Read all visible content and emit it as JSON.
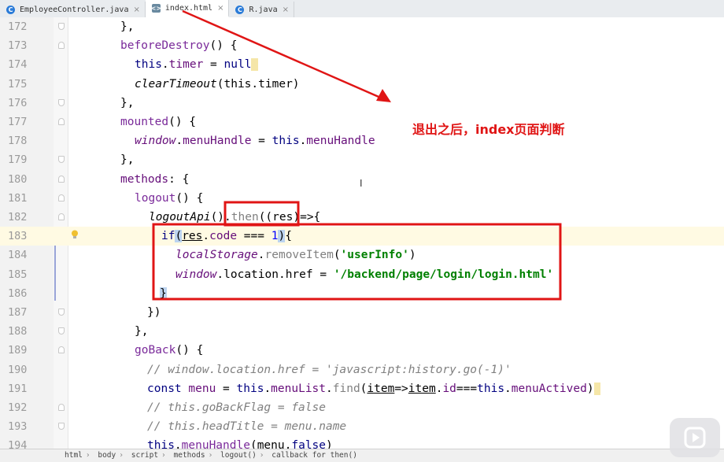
{
  "tabs": [
    {
      "label": "EmployeeController.java",
      "icon": "java-class-icon",
      "active": false
    },
    {
      "label": "index.html",
      "icon": "html-file-icon",
      "active": true
    },
    {
      "label": "R.java",
      "icon": "java-class-icon",
      "active": false
    }
  ],
  "tab_close_glyph": "×",
  "lines": [
    {
      "n": "172"
    },
    {
      "n": "173"
    },
    {
      "n": "174"
    },
    {
      "n": "175"
    },
    {
      "n": "176"
    },
    {
      "n": "177"
    },
    {
      "n": "178"
    },
    {
      "n": "179"
    },
    {
      "n": "180"
    },
    {
      "n": "181"
    },
    {
      "n": "182"
    },
    {
      "n": "183"
    },
    {
      "n": "184"
    },
    {
      "n": "185"
    },
    {
      "n": "186"
    },
    {
      "n": "187"
    },
    {
      "n": "188"
    },
    {
      "n": "189"
    },
    {
      "n": "190"
    },
    {
      "n": "191"
    },
    {
      "n": "192"
    },
    {
      "n": "193"
    },
    {
      "n": "194"
    }
  ],
  "code": {
    "l172": "},",
    "l173_fn": "beforeDestroy",
    "l173_rest": "() {",
    "l174_kw": "this",
    "l174_prop": "timer",
    "l174_eq": " = ",
    "l174_null": "null",
    "l175_fn": "clearTimeout",
    "l175_rest": "(this.timer)",
    "l176": "},",
    "l177_fn": "mounted",
    "l177_rest": "() {",
    "l178_win": "window",
    "l178_prop": "menuHandle",
    "l178_eq": " = ",
    "l178_this": "this",
    "l178_prop2": "menuHandle",
    "l179": "},",
    "l180_prop": "methods",
    "l180_rest": ": {",
    "l181_fn": "logout",
    "l181_rest": "() {",
    "l182_fn": "logoutApi",
    "l182_paren": "()",
    "l182_then": "then",
    "l182_args": "((res)",
    "l182_arrow": "=>{",
    "l183_if": "if",
    "l183_res": "res",
    "l183_code": "code",
    "l183_op": " === ",
    "l183_num": "1",
    "l183_end": "{",
    "l184_ls": "localStorage",
    "l184_fn": "removeItem",
    "l184_str": "'userInfo'",
    "l185_win": "window",
    "l185_prop": "location",
    "l185_href": "href",
    "l185_eq": " = ",
    "l185_str": "'/backend/page/login/login.html'",
    "l186": "}",
    "l187": "})",
    "l188": "},",
    "l189_fn": "goBack",
    "l189_rest": "() {",
    "l190": "// window.location.href = 'javascript:history.go(-1)'",
    "l191_kw": "const",
    "l191_var": "menu",
    "l191_eq": " = ",
    "l191_this": "this",
    "l191_list": "menuList",
    "l191_find": "find",
    "l191_item": "item",
    "l191_arrow": "=>",
    "l191_item2": "item",
    "l191_id": "id",
    "l191_cmp": "===",
    "l191_this2": "this",
    "l191_active": "menuActived",
    "l192": "// this.goBackFlag = false",
    "l193": "// this.headTitle = menu.name",
    "l194_this": "this",
    "l194_fn": "menuHandle",
    "l194_menu": "menu",
    "l194_false": "false"
  },
  "annotation": {
    "text": "退出之后，index页面判断",
    "color": "#e01515"
  },
  "breadcrumb": [
    "html",
    "body",
    "script",
    "methods",
    "logout()",
    "callback for then()"
  ],
  "breadcrumb_sep": "›",
  "colors": {
    "accent_red": "#e01515",
    "selection": "#bcd4f0",
    "current_line": "#fffae3"
  }
}
